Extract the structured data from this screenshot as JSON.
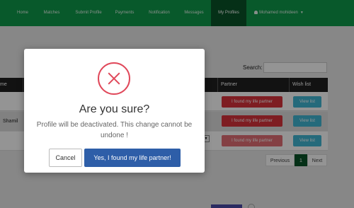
{
  "navbar": {
    "items": [
      "Home",
      "Matches",
      "Submit Profile",
      "Payments",
      "Notification",
      "Messages",
      "My Profiles"
    ],
    "active": "My Profiles",
    "user_name": "Mohamed mohideen"
  },
  "search": {
    "label": "Search:",
    "value": ""
  },
  "table": {
    "headers": [
      "me",
      "Partner",
      "Wish list"
    ],
    "rows": [
      {
        "name": "",
        "partner_label": "I found my life partner",
        "wish_label": "View list"
      },
      {
        "name": "Shamil",
        "partner_label": "I found my life partner",
        "wish_label": "View list"
      },
      {
        "name": "",
        "partner_label": "I found my life partner",
        "wish_label": "View list"
      }
    ]
  },
  "pagination": {
    "previous": "Previous",
    "current": "1",
    "next": "Next"
  },
  "modal": {
    "title": "Are you sure?",
    "text": "Profile will be deactivated. This change cannot be undone !",
    "cancel_label": "Cancel",
    "confirm_label": "Yes, I found my life partner!",
    "icon": "error-x-icon"
  },
  "colors": {
    "navbar": "#0f9a4a",
    "navbar_active": "#0a5428",
    "danger": "#d9323b",
    "info": "#40b7d4",
    "confirm": "#2e5ea8",
    "error_icon": "#e0485a"
  }
}
